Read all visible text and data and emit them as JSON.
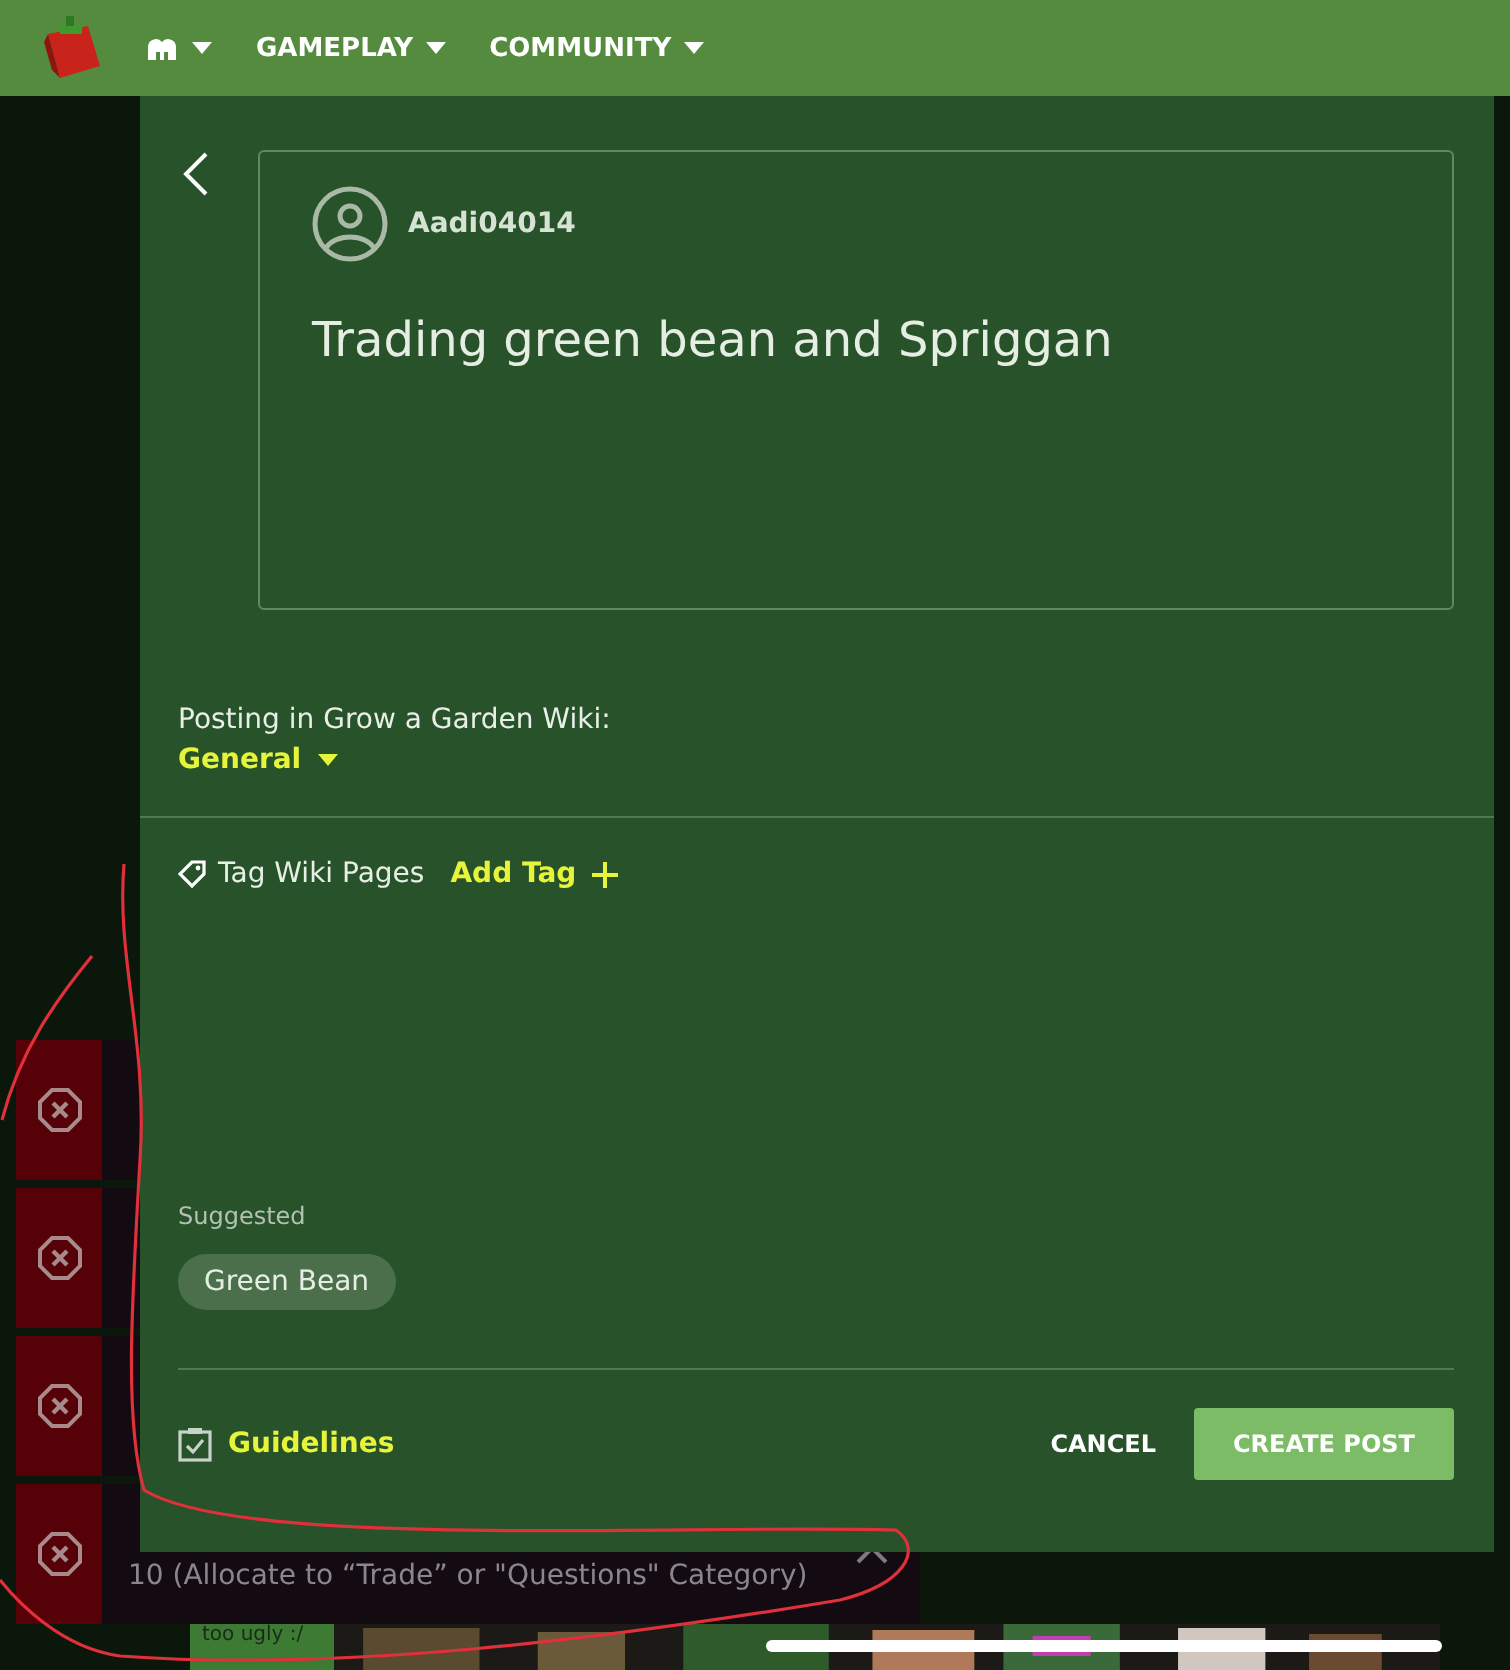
{
  "nav": {
    "items": [
      {
        "kind": "icon"
      },
      {
        "kind": "text",
        "label": "GAMEPLAY"
      },
      {
        "kind": "text",
        "label": "COMMUNITY"
      }
    ]
  },
  "background": {
    "notifications": [
      {
        "kind": "covered"
      },
      {
        "kind": "covered"
      },
      {
        "kind": "covered"
      },
      {
        "kind": "open",
        "detail": "10 (Allocate to “Trade” or \"Questions\" Category)"
      }
    ],
    "caption": "too ugly :/"
  },
  "post": {
    "author": "Aadi04014",
    "title": "Trading green bean and Spriggan"
  },
  "posting": {
    "label": "Posting in Grow a Garden Wiki:",
    "category": "General"
  },
  "tags": {
    "label": "Tag Wiki Pages",
    "add": "Add Tag"
  },
  "suggested": {
    "label": "Suggested",
    "chips": [
      "Green Bean"
    ]
  },
  "footer": {
    "guidelines": "Guidelines",
    "buttons": [
      {
        "kind": "text",
        "label": "CANCEL"
      },
      {
        "kind": "primary",
        "label": "CREATE POST"
      }
    ]
  }
}
